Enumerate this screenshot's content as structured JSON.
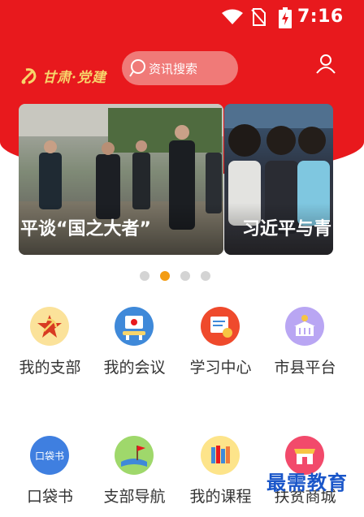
{
  "status_bar": {
    "time": "7:16"
  },
  "header": {
    "logo_text": "甘肃·党建",
    "search_placeholder": "资讯搜索"
  },
  "carousel": {
    "slides": [
      {
        "caption": "平谈“国之大者”"
      },
      {
        "caption": "习近平与青"
      }
    ],
    "active_index": 1,
    "dot_count": 4
  },
  "grid": [
    {
      "label": "我的支部",
      "icon": "party-emblem-icon"
    },
    {
      "label": "我的会议",
      "icon": "meeting-icon"
    },
    {
      "label": "学习中心",
      "icon": "study-center-icon"
    },
    {
      "label": "市县平台",
      "icon": "city-platform-icon"
    },
    {
      "label": "口袋书",
      "icon": "pocket-book-icon",
      "icon_text": "口袋书"
    },
    {
      "label": "支部导航",
      "icon": "branch-navigation-icon"
    },
    {
      "label": "我的课程",
      "icon": "courses-icon"
    },
    {
      "label": "扶贫商城",
      "icon": "poverty-mall-icon"
    }
  ],
  "watermark": "最需教育",
  "colors": {
    "brand_red": "#e8191d",
    "accent_dot": "#f39c12"
  }
}
